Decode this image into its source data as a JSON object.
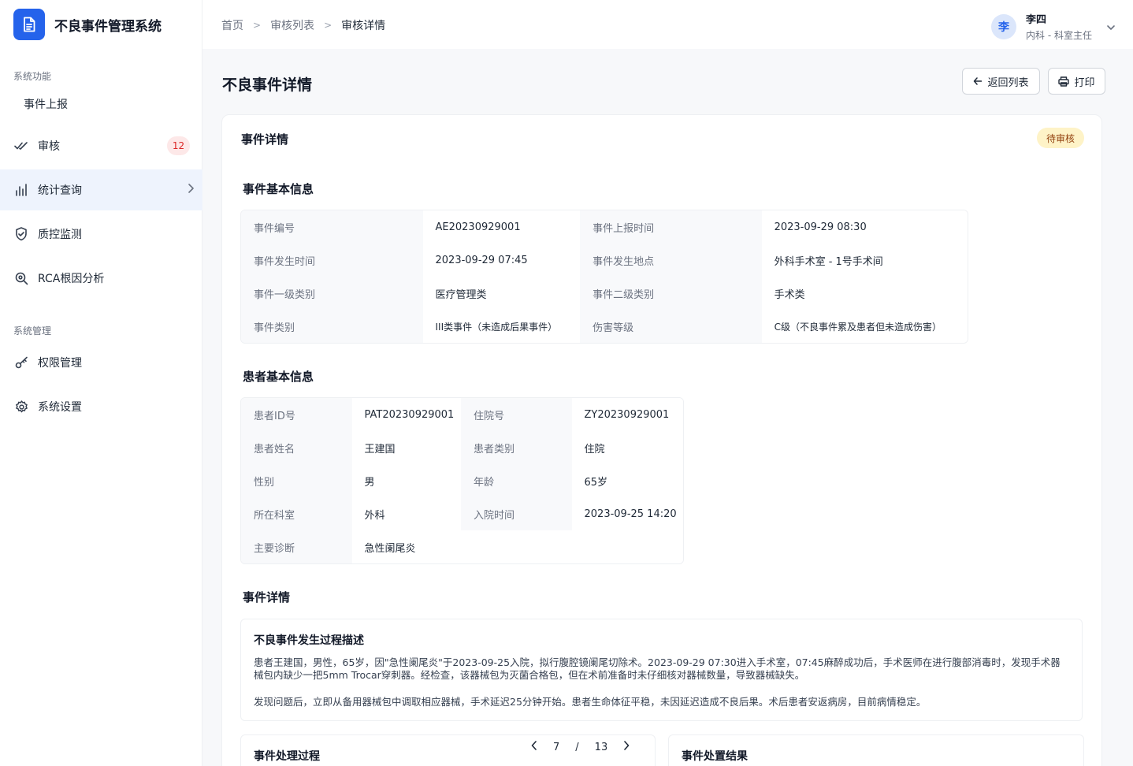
{
  "app": {
    "title": "不良事件管理系统"
  },
  "sidebar": {
    "sections": [
      {
        "label": "系统功能"
      },
      {
        "label": "系统管理"
      }
    ],
    "items": [
      {
        "label": "事件上报"
      },
      {
        "label": "审核",
        "badge": "12"
      },
      {
        "label": "统计查询"
      },
      {
        "label": "质控监测"
      },
      {
        "label": "RCA根因分析"
      },
      {
        "label": "权限管理"
      },
      {
        "label": "系统设置"
      }
    ]
  },
  "breadcrumb": {
    "items": [
      "首页",
      "审核列表",
      "审核详情"
    ]
  },
  "user": {
    "avatar": "李",
    "name": "李四",
    "role": "内科 - 科室主任"
  },
  "page": {
    "title": "不良事件详情",
    "back_label": "返回列表",
    "print_label": "打印"
  },
  "card": {
    "title": "事件详情",
    "status": "待审核",
    "event_section": {
      "title": "事件基本信息",
      "rows": [
        [
          "事件编号",
          "AE20230929001",
          "事件上报时间",
          "2023-09-29 08:30"
        ],
        [
          "事件发生时间",
          "2023-09-29 07:45",
          "事件发生地点",
          "外科手术室 - 1号手术间"
        ],
        [
          "事件一级类别",
          "医疗管理类",
          "事件二级类别",
          "手术类"
        ],
        [
          "事件类别",
          "III类事件（未造成后果事件）",
          "伤害等级",
          "C级（不良事件累及患者但未造成伤害）"
        ]
      ]
    },
    "patient_section": {
      "title": "患者基本信息",
      "rows": [
        [
          "患者ID号",
          "PAT20230929001",
          "住院号",
          "ZY20230929001"
        ],
        [
          "患者姓名",
          "王建国",
          "患者类别",
          "住院"
        ],
        [
          "性别",
          "男",
          "年龄",
          "65岁"
        ],
        [
          "所在科室",
          "外科",
          "入院时间",
          "2023-09-25 14:20"
        ],
        [
          "主要诊断",
          "急性阑尾炎"
        ]
      ]
    },
    "detail_section": {
      "title": "事件详情",
      "box_title": "不良事件发生过程描述",
      "para1_line1": "患者王建国，男性，65岁，因\"急性阑尾炎\"于2023-09-25入院，拟行腹腔镜阑尾切除术。2023-09-29 07:30进入手术室，07:45麻醉成功后，手术医师在进行腹部消毒时，发现手术器",
      "para1_line2": "械包内缺少一把5mm Trocar穿刺器。经检查，该器械包为灭菌合格包，但在术前准备时未仔细核对器械数量，导致器械缺失。",
      "para2": "发现问题后，立即从备用器械包中调取相应器械，手术延迟25分钟开始。患者生命体征平稳，未因延迟造成不良后果。术后患者安返病房，目前病情稳定。"
    },
    "process_title": "事件处理过程",
    "result_title": "事件处置结果"
  },
  "pager": {
    "current": "7",
    "sep": "/",
    "total": "13"
  },
  "colors": {
    "accent": "#2563eb",
    "badge_bg": "#fde8e8",
    "status_bg": "#fef3c7"
  }
}
